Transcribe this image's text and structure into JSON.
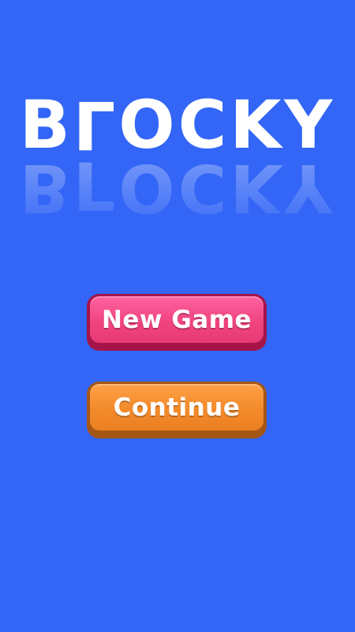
{
  "screen": {
    "background_color": "#3366f6"
  },
  "logo": {
    "title_before_flip": "B",
    "flipped_letter": "L",
    "title_after_flip": "OCKY",
    "reflection_before_flip": "B",
    "reflection_flipped_letter": "L",
    "reflection_after_flip": "OCKY"
  },
  "menu": {
    "new_game_label": "New Game",
    "new_game_color": "#f0447f",
    "continue_label": "Continue",
    "continue_color": "#f28a2a"
  }
}
